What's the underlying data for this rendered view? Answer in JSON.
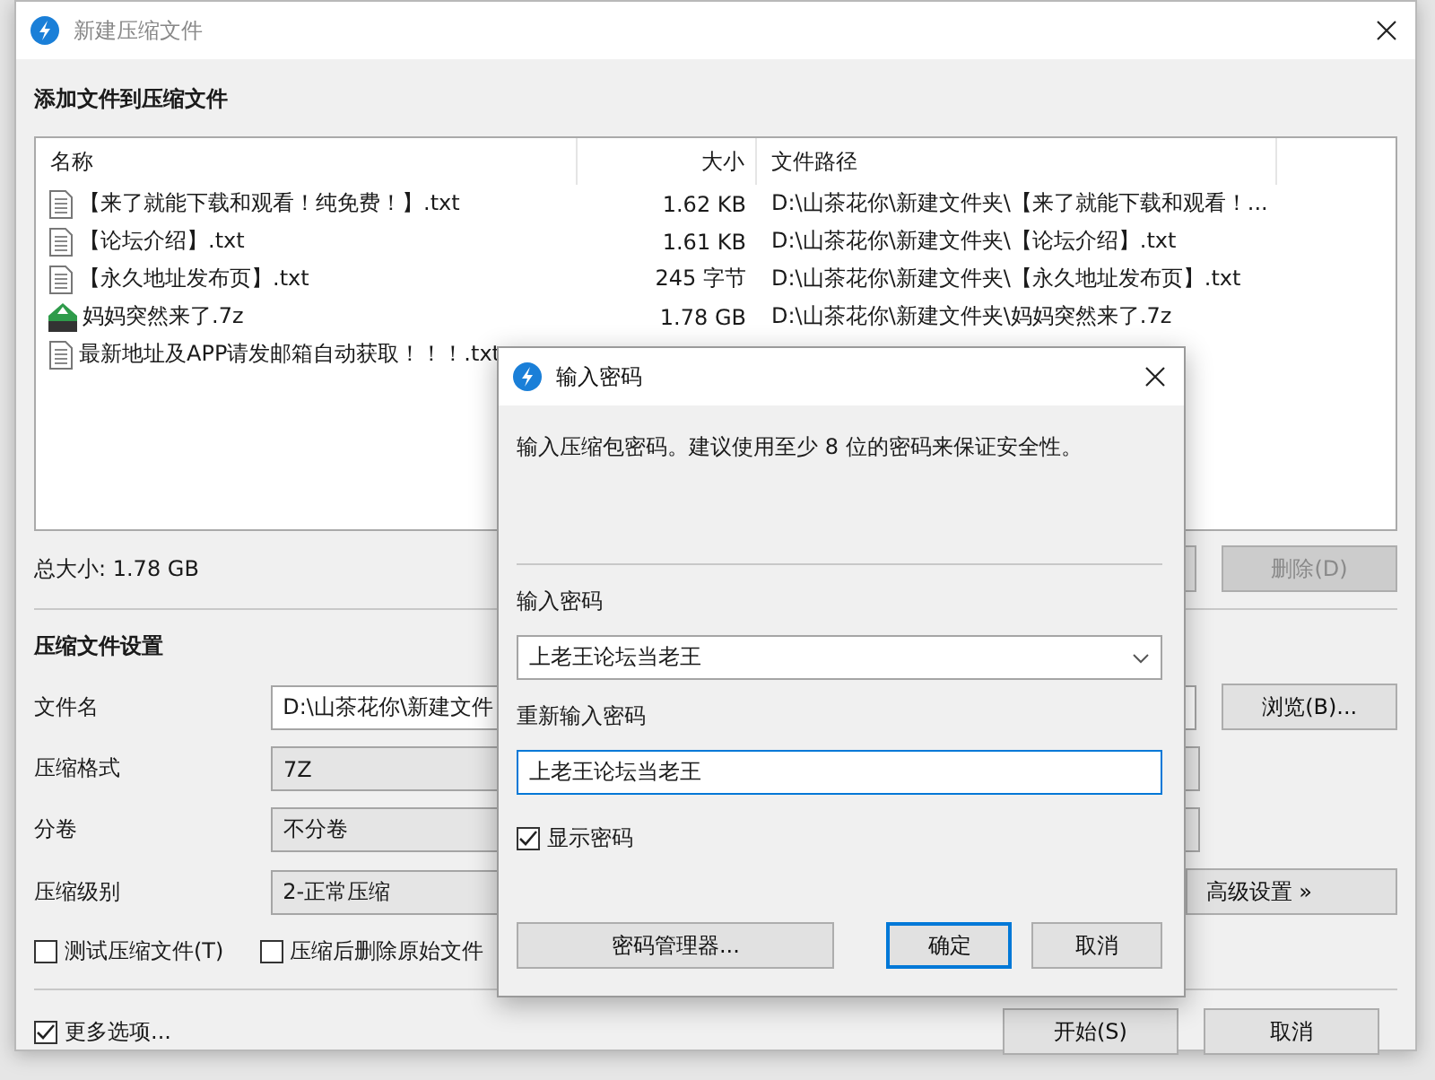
{
  "window": {
    "title": "新建压缩文件"
  },
  "header": "添加文件到压缩文件",
  "file_list": {
    "columns": [
      "名称",
      "大小",
      "文件路径"
    ],
    "rows": [
      {
        "kind": "text",
        "name": "【来了就能下载和观看！纯免费！】.txt",
        "size": "1.62 KB",
        "path": "D:\\山茶花你\\新建文件夹\\【来了就能下载和观看！..."
      },
      {
        "kind": "text",
        "name": "【论坛介绍】.txt",
        "size": "1.61 KB",
        "path": "D:\\山茶花你\\新建文件夹\\【论坛介绍】.txt"
      },
      {
        "kind": "text",
        "name": "【永久地址发布页】.txt",
        "size": "245 字节",
        "path": "D:\\山茶花你\\新建文件夹\\【永久地址发布页】.txt"
      },
      {
        "kind": "archive",
        "name": "妈妈突然来了.7z",
        "size": "1.78 GB",
        "path": "D:\\山茶花你\\新建文件夹\\妈妈突然来了.7z"
      },
      {
        "kind": "text",
        "name": "最新地址及APP请发邮箱自动获取！！！.txt"
      }
    ]
  },
  "total_size": "总大小: 1.78 GB",
  "delete_button": {
    "label": "删除(D)",
    "disabled": true
  },
  "settings": {
    "title": "压缩文件设置",
    "fields": [
      {
        "kind": "input",
        "label": "文件名",
        "value": "D:\\山茶花你\\新建文件"
      },
      {
        "kind": "select",
        "label": "压缩格式",
        "value": "7Z"
      },
      {
        "kind": "select",
        "label": "分卷",
        "value": "不分卷"
      },
      {
        "kind": "select",
        "label": "压缩级别",
        "value": "2-正常压缩"
      }
    ],
    "browse_button": "浏览(B)...",
    "advanced_button": "高级设置 »",
    "options": [
      {
        "label": "测试压缩文件(T)",
        "checked": false
      },
      {
        "label": "压缩后删除原始文件",
        "checked": false
      }
    ]
  },
  "more_options": {
    "label": "更多选项...",
    "checked": true
  },
  "footer_buttons": [
    "开始(S)",
    "取消"
  ],
  "dialog": {
    "title": "输入密码",
    "description": "输入压缩包密码。建议使用至少 8 位的密码来保证安全性。",
    "password_label": "输入密码",
    "password_value": "上老王论坛当老王",
    "confirm_label": "重新输入密码",
    "confirm_value": "上老王论坛当老王",
    "show_password": {
      "label": "显示密码",
      "checked": true
    },
    "buttons": [
      {
        "label": "密码管理器...",
        "default": false
      },
      {
        "label": "确定",
        "default": true
      },
      {
        "label": "取消",
        "default": false
      }
    ]
  }
}
